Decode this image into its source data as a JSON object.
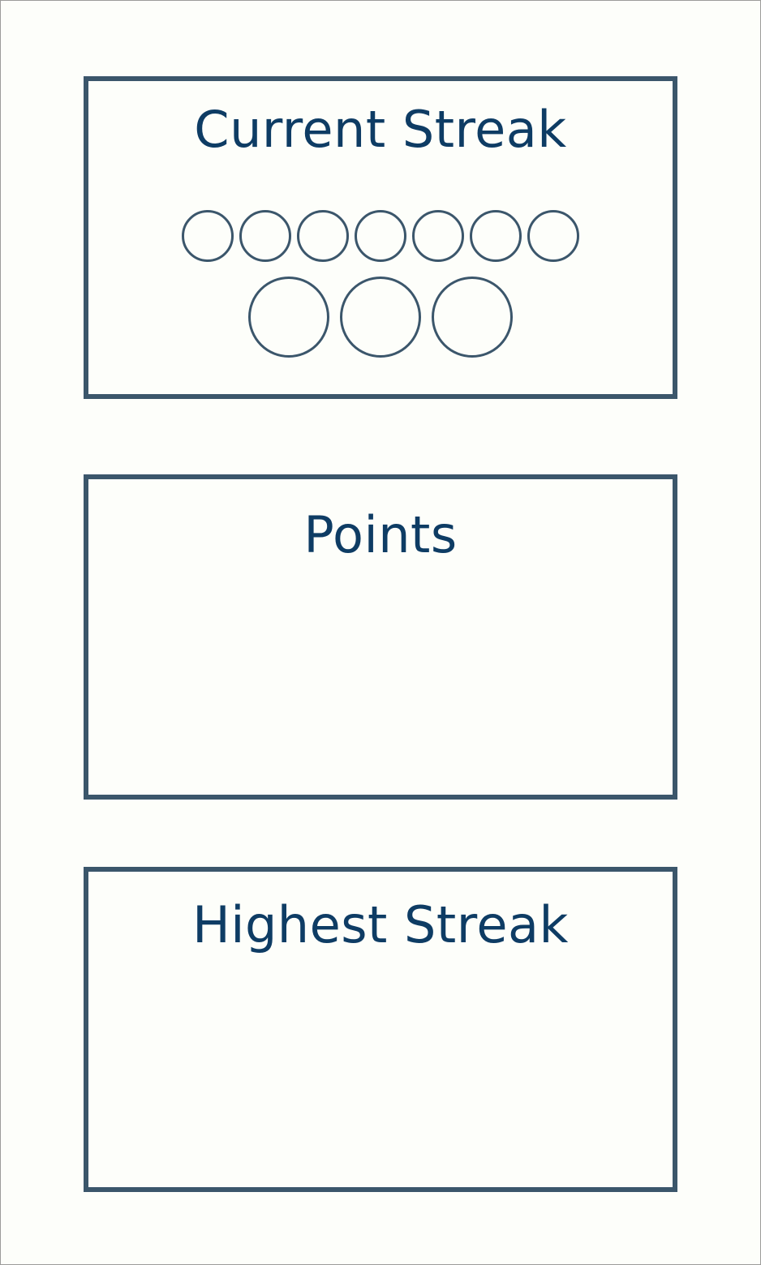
{
  "cards": {
    "current_streak": {
      "title": "Current Streak",
      "small_circle_count": 7,
      "large_circle_count": 3
    },
    "points": {
      "title": "Points"
    },
    "highest_streak": {
      "title": "Highest Streak"
    }
  },
  "colors": {
    "background": "#fdfefa",
    "border": "#3b566b",
    "title_text": "#0e3c64"
  }
}
